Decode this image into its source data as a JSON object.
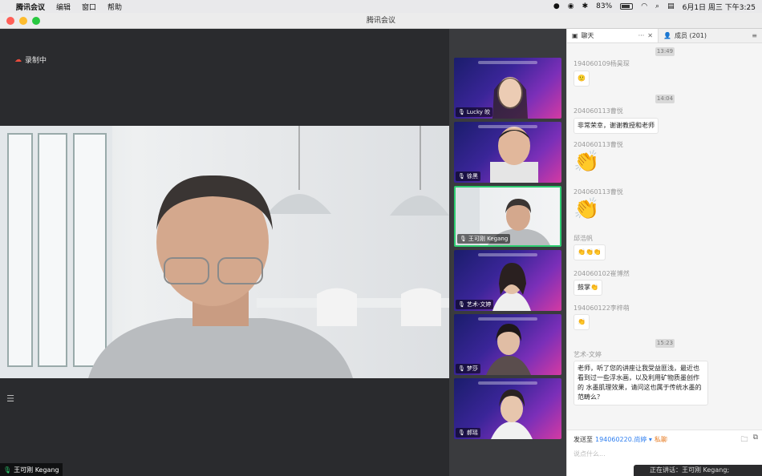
{
  "menubar": {
    "app_name": "腾讯会议",
    "menus": [
      "编辑",
      "窗口",
      "帮助"
    ],
    "battery": "83%",
    "datetime": "6月1日 周三 下午3:25"
  },
  "window": {
    "title": "腾讯会议"
  },
  "stage": {
    "recording_label": "录制中",
    "speaker_name": "王可刚 Kegang"
  },
  "thumbnails": [
    {
      "name": "Lucky 皎"
    },
    {
      "name": "徐黑"
    },
    {
      "name": "王可刚 Kegang"
    },
    {
      "name": "艺术-文婷"
    },
    {
      "name": "梦莎"
    },
    {
      "name": "郝瑶"
    }
  ],
  "chat": {
    "tab_label": "聊天",
    "members_label": "成员 (201)",
    "timestamps": [
      "13:49",
      "14:04",
      "15:23"
    ],
    "messages": [
      {
        "sender": "194060109杨昊琛",
        "content": "🙂"
      },
      {
        "sender": "204060113曹悦",
        "content": "非常荣幸，谢谢教授和老师"
      },
      {
        "sender": "204060113曹悦",
        "content": "👏"
      },
      {
        "sender": "204060113曹悦",
        "content": "👏"
      },
      {
        "sender": "邱浩帆",
        "content": "👏👏👏"
      },
      {
        "sender": "204060102崔博然",
        "content": "鼓掌👏"
      },
      {
        "sender": "194060122李梓萌",
        "content": "👏"
      },
      {
        "sender": "艺术-文婷",
        "content": "老师，听了您的讲座让我受益匪浅，最近也看到过一些浮水画，以及利用矿物质墨创作的 水墨肌理效果，请问这也属于传统水墨的范畴么？"
      }
    ],
    "send_to_label": "发送至",
    "send_to_target": "194060220.尚婷 ▾",
    "private_label": "私聊",
    "input_placeholder": "说点什么..."
  },
  "toast": {
    "text": "正在讲话：王可刚 Kegang;"
  }
}
